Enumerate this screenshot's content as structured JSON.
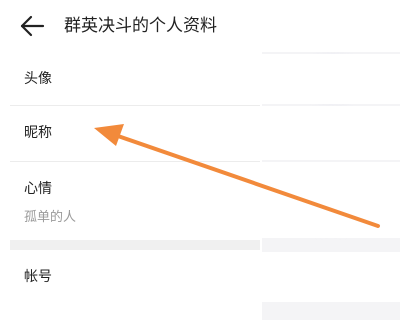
{
  "header": {
    "back_icon": "back-arrow-icon",
    "title": "群英决斗的个人资料"
  },
  "profile": {
    "avatar_label": "头像",
    "nickname_label": "昵称",
    "mood_label": "心情",
    "mood_value": "孤单的人",
    "account_label": "帐号"
  },
  "annotation": {
    "color": "#f28a3b",
    "points_to": "nickname-row"
  }
}
